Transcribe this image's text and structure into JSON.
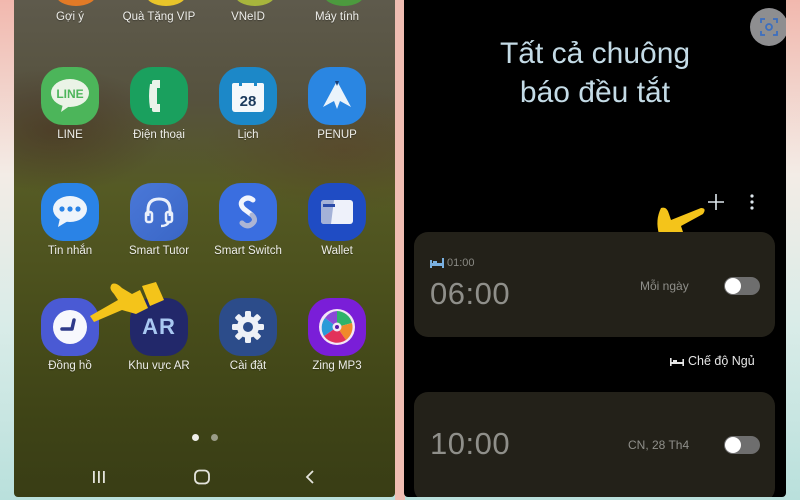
{
  "home_screen": {
    "top_row_partial": [
      {
        "label": "Gợi ý",
        "icon": "suggestions-icon",
        "color": "#e27a26"
      },
      {
        "label": "Quà Tặng VIP",
        "icon": "vip-gift-icon",
        "color": "#e9c52a"
      },
      {
        "label": "VNeID",
        "icon": "vneid-icon",
        "color": "#a7b53c"
      },
      {
        "label": "Máy tính",
        "icon": "calculator-icon",
        "color": "#4c9a3e"
      }
    ],
    "apps": [
      {
        "label": "LINE",
        "icon": "line-icon",
        "color": "#4cb55a",
        "glyph": "LINE"
      },
      {
        "label": "Điện thoại",
        "icon": "phone-icon",
        "color": "#1aa05e"
      },
      {
        "label": "Lịch",
        "icon": "calendar-icon",
        "color": "#1c88c8",
        "glyph": "28"
      },
      {
        "label": "PENUP",
        "icon": "penup-icon",
        "color": "#2a86e2"
      },
      {
        "label": "Tin nhắn",
        "icon": "messages-icon",
        "color": "#2a83e6"
      },
      {
        "label": "Smart Tutor",
        "icon": "smart-tutor-icon",
        "color": "#3e74d4"
      },
      {
        "label": "Smart Switch",
        "icon": "smart-switch-icon",
        "color": "#3a6ee0"
      },
      {
        "label": "Wallet",
        "icon": "wallet-icon",
        "color": "#1f4cc4"
      },
      {
        "label": "Đồng hồ",
        "icon": "clock-icon",
        "color": "#4a5ad4"
      },
      {
        "label": "Khu vực AR",
        "icon": "ar-zone-icon",
        "color": "#22286a",
        "glyph": "AR"
      },
      {
        "label": "Cài đặt",
        "icon": "settings-icon",
        "color": "#2c4c8a"
      },
      {
        "label": "Zing MP3",
        "icon": "zing-mp3-icon",
        "color": "#7a1ed8"
      }
    ],
    "page_indicator": {
      "pages": 2,
      "current": 1
    },
    "nav": {
      "recents": "recents-icon",
      "home": "home-icon",
      "back": "back-icon"
    },
    "pointer_target": "Đồng hồ"
  },
  "clock_app": {
    "title": "Tất cả chuông báo đều tắt",
    "title_line1": "Tất cả chuông",
    "title_line2": "báo đều tắt",
    "pointer_target": "add-alarm",
    "alarms": [
      {
        "bedtime": "01:00",
        "time": "06:00",
        "repeat": "Mỗi ngày",
        "enabled": false
      },
      {
        "time": "10:00",
        "repeat": "CN, 28 Th4",
        "enabled": false
      }
    ],
    "sleep_mode_label": "Chế độ Ngủ"
  },
  "colors": {
    "pointer_hand": "#f4c41a",
    "title_text": "#c4dbe6",
    "card_bg": "#232119"
  }
}
